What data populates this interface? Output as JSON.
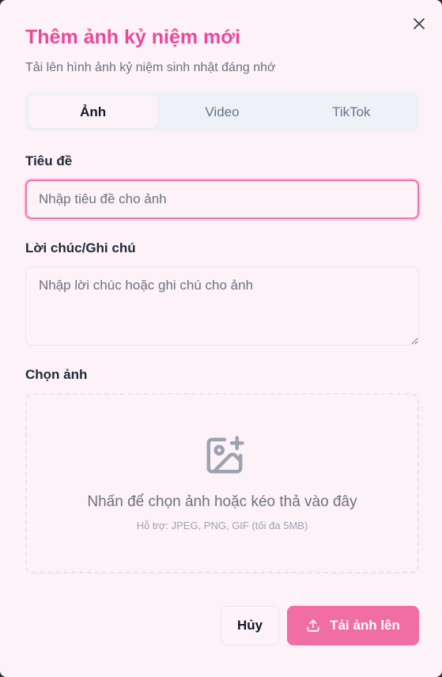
{
  "dialog": {
    "title": "Thêm ảnh kỷ niệm mới",
    "subtitle": "Tải lên hình ảnh kỷ niệm sinh nhật đáng nhớ",
    "close_icon": "close-icon"
  },
  "tabs": [
    {
      "label": "Ảnh",
      "active": true
    },
    {
      "label": "Video",
      "active": false
    },
    {
      "label": "TikTok",
      "active": false
    }
  ],
  "form": {
    "title_label": "Tiêu đề",
    "title_placeholder": "Nhập tiêu đề cho ảnh",
    "title_value": "",
    "note_label": "Lời chúc/Ghi chú",
    "note_placeholder": "Nhập lời chúc hoặc ghi chú cho ảnh",
    "note_value": "",
    "image_label": "Chọn ảnh"
  },
  "dropzone": {
    "icon": "image-plus-icon",
    "text": "Nhấn để chọn ảnh hoặc kéo thả vào đây",
    "hint": "Hỗ trợ: JPEG, PNG, GIF (tối đa 5MB)"
  },
  "actions": {
    "cancel_label": "Hủy",
    "upload_label": "Tải ảnh lên",
    "upload_icon": "upload-icon"
  },
  "colors": {
    "accent": "#ec4899",
    "button": "#f06ea1",
    "background": "#fdf2f8"
  }
}
